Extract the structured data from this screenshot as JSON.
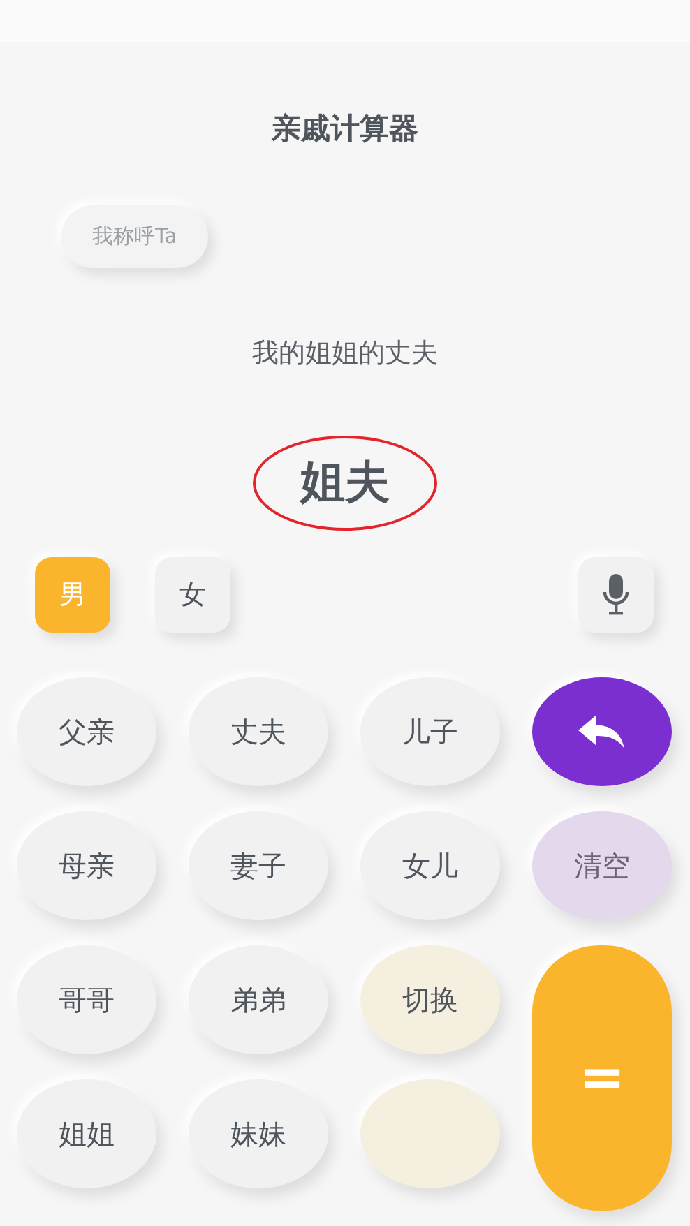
{
  "title": "亲戚计算器",
  "mode_button": "我称呼Ta",
  "expression": "我的姐姐的丈夫",
  "result": "姐夫",
  "result_circled": true,
  "gender": [
    {
      "label": "男",
      "selected": true
    },
    {
      "label": "女",
      "selected": false
    }
  ],
  "keys": [
    {
      "kind": "relation",
      "label": "父亲"
    },
    {
      "kind": "relation",
      "label": "丈夫"
    },
    {
      "kind": "relation",
      "label": "儿子"
    },
    {
      "kind": "back"
    },
    {
      "kind": "relation",
      "label": "母亲"
    },
    {
      "kind": "relation",
      "label": "妻子"
    },
    {
      "kind": "relation",
      "label": "女儿"
    },
    {
      "kind": "clear",
      "label": "清空"
    },
    {
      "kind": "relation",
      "label": "哥哥"
    },
    {
      "kind": "relation",
      "label": "弟弟"
    },
    {
      "kind": "switch",
      "label": "切换"
    },
    {
      "kind": "equals",
      "label": "="
    },
    {
      "kind": "relation",
      "label": "姐姐"
    },
    {
      "kind": "relation",
      "label": "妹妹"
    },
    {
      "kind": "switch"
    }
  ]
}
